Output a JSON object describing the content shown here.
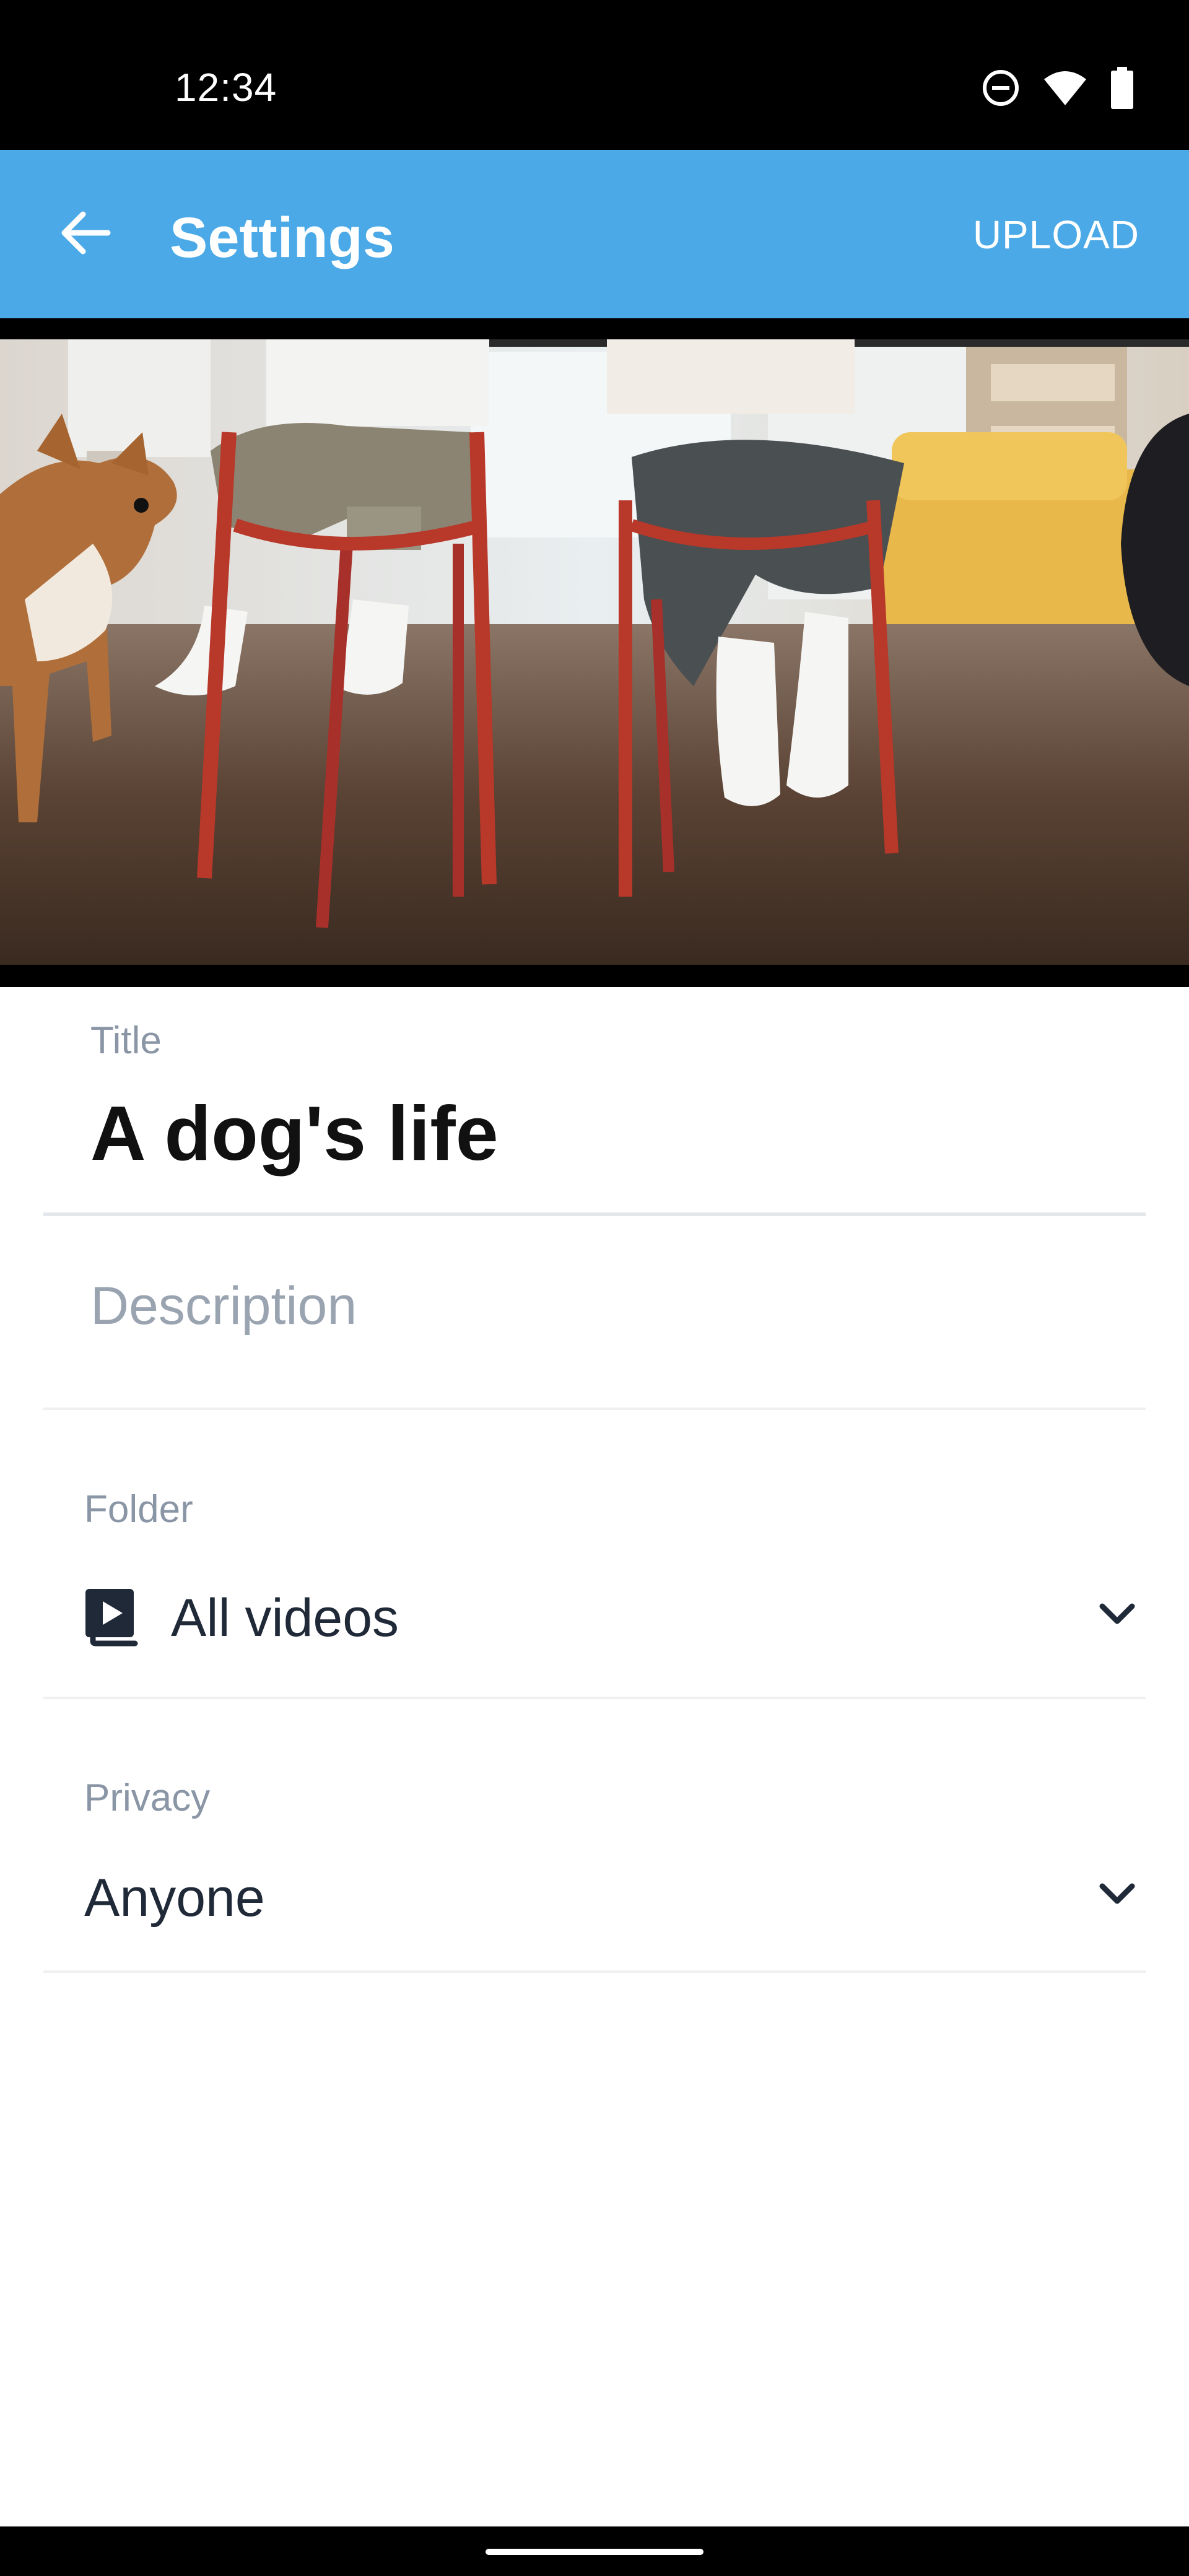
{
  "status_bar": {
    "time": "12:34",
    "icons": [
      "do-not-disturb-icon",
      "wifi-icon",
      "battery-icon"
    ]
  },
  "app_bar": {
    "title": "Settings",
    "action_label": "UPLOAD",
    "back_icon": "arrow-back-icon",
    "background_color": "#4aa9e6"
  },
  "form": {
    "title": {
      "label": "Title",
      "value": "A dog's life"
    },
    "description": {
      "placeholder": "Description",
      "value": ""
    },
    "folder": {
      "label": "Folder",
      "value": "All videos",
      "icon": "video-library-icon"
    },
    "privacy": {
      "label": "Privacy",
      "value": "Anyone"
    }
  }
}
